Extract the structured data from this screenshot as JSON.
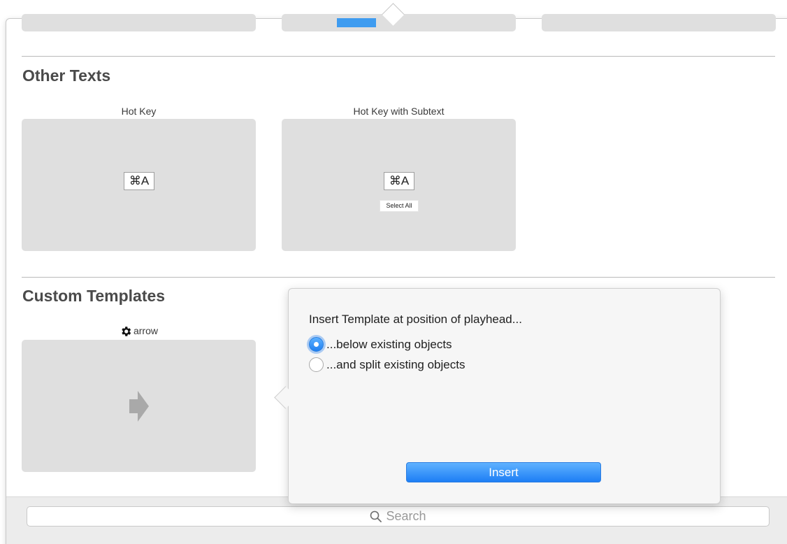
{
  "sections": {
    "other_texts": {
      "title": "Other Texts",
      "tiles": [
        {
          "label": "Hot Key",
          "hotkey": "⌘A"
        },
        {
          "label": "Hot Key with Subtext",
          "hotkey": "⌘A",
          "subtext": "Select All"
        }
      ]
    },
    "custom_templates": {
      "title": "Custom Templates",
      "tiles": [
        {
          "label": "arrow",
          "icon": "gear-icon",
          "preview_icon": "arrow-right-icon"
        }
      ]
    }
  },
  "insert_popover": {
    "heading": "Insert Template at position of playhead...",
    "options": [
      {
        "label": "...below existing objects",
        "selected": true
      },
      {
        "label": "...and split existing objects",
        "selected": false
      }
    ],
    "insert_label": "Insert"
  },
  "search": {
    "placeholder": "Search",
    "icon": "magnifier-icon"
  },
  "colors": {
    "accent": "#1d7ef5",
    "tile_bg": "#dfdfdf",
    "swatch": "#3f9cf0"
  }
}
